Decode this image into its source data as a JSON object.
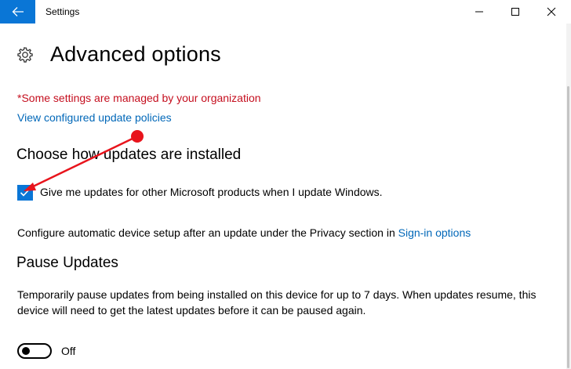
{
  "window": {
    "title": "Settings"
  },
  "page": {
    "title": "Advanced options",
    "managed_notice": "*Some settings are managed by your organization",
    "policies_link": "View configured update policies"
  },
  "install_section": {
    "heading": "Choose how updates are installed",
    "checkbox_label": "Give me updates for other Microsoft products when I update Windows.",
    "checkbox_checked": true,
    "device_setup_text": "Configure automatic device setup after an update under the Privacy section in",
    "sign_in_link": "Sign-in options"
  },
  "pause_section": {
    "heading": "Pause Updates",
    "description": "Temporarily pause updates from being installed on this device for up to 7 days. When updates resume, this device will need to get the latest updates before it can be paused again.",
    "toggle_state": "Off"
  },
  "colors": {
    "accent": "#0a76d6",
    "link": "#0067b8",
    "warning": "#c50f1f",
    "annotation": "#e8141c"
  },
  "icons": {
    "back": "arrow-left-icon",
    "settings": "gear-icon",
    "minimize": "minimize-icon",
    "maximize": "maximize-icon",
    "close": "close-icon",
    "check": "checkmark-icon"
  }
}
